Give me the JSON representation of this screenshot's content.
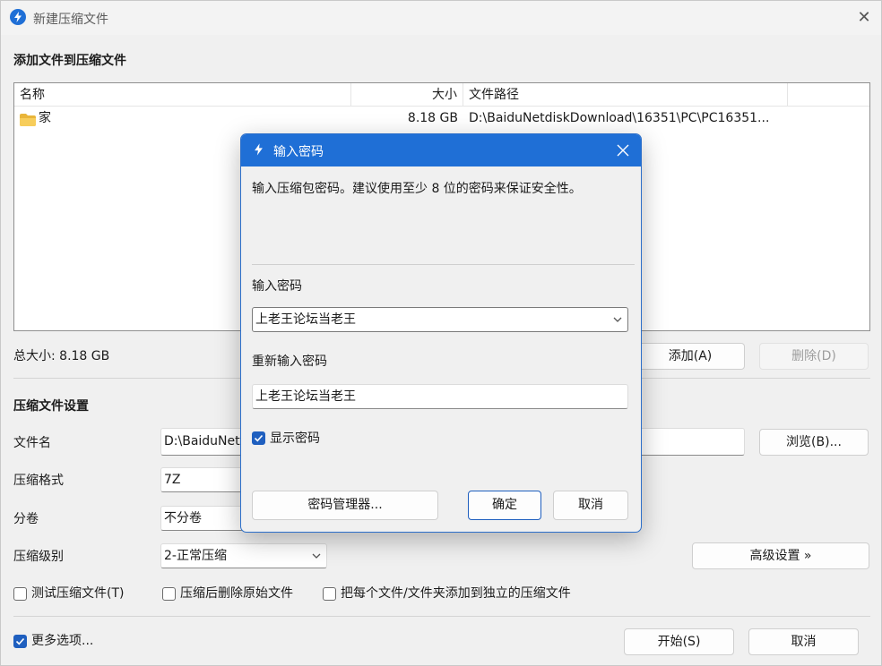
{
  "window": {
    "title": "新建压缩文件",
    "close_glyph": "✕"
  },
  "files_section": {
    "title": "添加文件到压缩文件",
    "columns": [
      "名称",
      "大小",
      "文件路径"
    ],
    "rows": [
      {
        "name": "家",
        "size": "8.18 GB",
        "path": "D:\\BaiduNetdiskDownload\\16351\\PC\\PC16351..."
      }
    ]
  },
  "total_size": "总大小: 8.18 GB",
  "buttons": {
    "add": "添加(A)",
    "delete": "删除(D)",
    "browse": "浏览(B)...",
    "advanced": "高级设置 »",
    "start": "开始(S)",
    "cancel": "取消"
  },
  "settings": {
    "title": "压缩文件设置",
    "filename_label": "文件名",
    "filename_value": "D:\\BaiduNet",
    "format_label": "压缩格式",
    "format_value": "7Z",
    "split_label": "分卷",
    "split_value": "不分卷",
    "level_label": "压缩级别",
    "level_value": "2-正常压缩"
  },
  "options": {
    "test": {
      "label": "测试压缩文件(T)",
      "checked": false
    },
    "delete_source": {
      "label": "压缩后删除原始文件",
      "checked": false
    },
    "separate": {
      "label": "把每个文件/文件夹添加到独立的压缩文件",
      "checked": false
    },
    "more": {
      "label": "更多选项...",
      "checked": true
    }
  },
  "dialog": {
    "title": "输入密码",
    "description": "输入压缩包密码。建议使用至少 8 位的密码来保证安全性。",
    "password_label": "输入密码",
    "password_value": "上老王论坛当老王",
    "reenter_label": "重新输入密码",
    "reenter_value": "上老王论坛当老王",
    "show_password": {
      "label": "显示密码",
      "checked": true
    },
    "manager_button": "密码管理器...",
    "ok_button": "确定",
    "cancel_button": "取消"
  },
  "colors": {
    "accent": "#1f6fd6",
    "checkbox": "#1f5fbf"
  },
  "icons": {
    "app": "lightning-bolt-icon",
    "folder": "folder-icon",
    "close": "close-icon",
    "chevron": "chevron-down-icon",
    "check": "check-icon"
  }
}
